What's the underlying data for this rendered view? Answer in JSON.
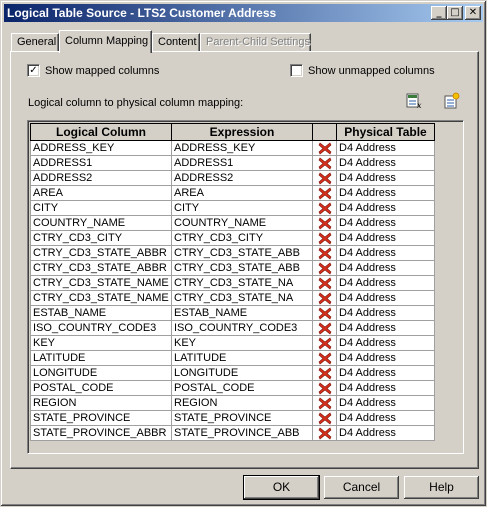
{
  "window": {
    "title": "Logical Table Source - LTS2 Customer Address",
    "minimize": "_",
    "maximize": "□",
    "close": "✕"
  },
  "tabs": [
    {
      "label": "General",
      "active": false,
      "disabled": false
    },
    {
      "label": "Column Mapping",
      "active": true,
      "disabled": false
    },
    {
      "label": "Content",
      "active": false,
      "disabled": false
    },
    {
      "label": "Parent-Child Settings",
      "active": false,
      "disabled": true
    }
  ],
  "options": {
    "show_mapped": {
      "label": "Show mapped columns",
      "checked": true
    },
    "show_unmapped": {
      "label": "Show unmapped columns",
      "checked": false
    }
  },
  "mapping_label": "Logical column to physical column mapping:",
  "toolbar": {
    "edit_icon": "expression-builder-icon",
    "new_icon": "new-mapping-icon"
  },
  "grid": {
    "headers": {
      "logical": "Logical Column",
      "expression": "Expression",
      "delete": "",
      "physical": "Physical Table"
    },
    "rows": [
      {
        "logical": "ADDRESS_KEY",
        "expression": "ADDRESS_KEY",
        "physical": "D4 Address"
      },
      {
        "logical": "ADDRESS1",
        "expression": "ADDRESS1",
        "physical": "D4 Address"
      },
      {
        "logical": "ADDRESS2",
        "expression": "ADDRESS2",
        "physical": "D4 Address"
      },
      {
        "logical": "AREA",
        "expression": "AREA",
        "physical": "D4 Address"
      },
      {
        "logical": "CITY",
        "expression": "CITY",
        "physical": "D4 Address"
      },
      {
        "logical": "COUNTRY_NAME",
        "expression": "COUNTRY_NAME",
        "physical": "D4 Address"
      },
      {
        "logical": "CTRY_CD3_CITY",
        "expression": "CTRY_CD3_CITY",
        "physical": "D4 Address"
      },
      {
        "logical": "CTRY_CD3_STATE_ABBR",
        "expression": "CTRY_CD3_STATE_ABB",
        "physical": "D4 Address"
      },
      {
        "logical": "CTRY_CD3_STATE_ABBR",
        "expression": "CTRY_CD3_STATE_ABB",
        "physical": "D4 Address"
      },
      {
        "logical": "CTRY_CD3_STATE_NAME",
        "expression": "CTRY_CD3_STATE_NA",
        "physical": "D4 Address"
      },
      {
        "logical": "CTRY_CD3_STATE_NAME",
        "expression": "CTRY_CD3_STATE_NA",
        "physical": "D4 Address"
      },
      {
        "logical": "ESTAB_NAME",
        "expression": "ESTAB_NAME",
        "physical": "D4 Address"
      },
      {
        "logical": "ISO_COUNTRY_CODE3",
        "expression": "ISO_COUNTRY_CODE3",
        "physical": "D4 Address"
      },
      {
        "logical": "KEY",
        "expression": "KEY",
        "physical": "D4 Address"
      },
      {
        "logical": "LATITUDE",
        "expression": "LATITUDE",
        "physical": "D4 Address"
      },
      {
        "logical": "LONGITUDE",
        "expression": "LONGITUDE",
        "physical": "D4 Address"
      },
      {
        "logical": "POSTAL_CODE",
        "expression": "POSTAL_CODE",
        "physical": "D4 Address"
      },
      {
        "logical": "REGION",
        "expression": "REGION",
        "physical": "D4 Address"
      },
      {
        "logical": "STATE_PROVINCE",
        "expression": "STATE_PROVINCE",
        "physical": "D4 Address"
      },
      {
        "logical": "STATE_PROVINCE_ABBR",
        "expression": "STATE_PROVINCE_ABB",
        "physical": "D4 Address"
      }
    ]
  },
  "buttons": {
    "ok": "OK",
    "cancel": "Cancel",
    "help": "Help"
  },
  "colors": {
    "title_start": "#0a246a",
    "title_end": "#a6caf0",
    "delete_x": "#d9301c",
    "face": "#d4d0c8"
  }
}
